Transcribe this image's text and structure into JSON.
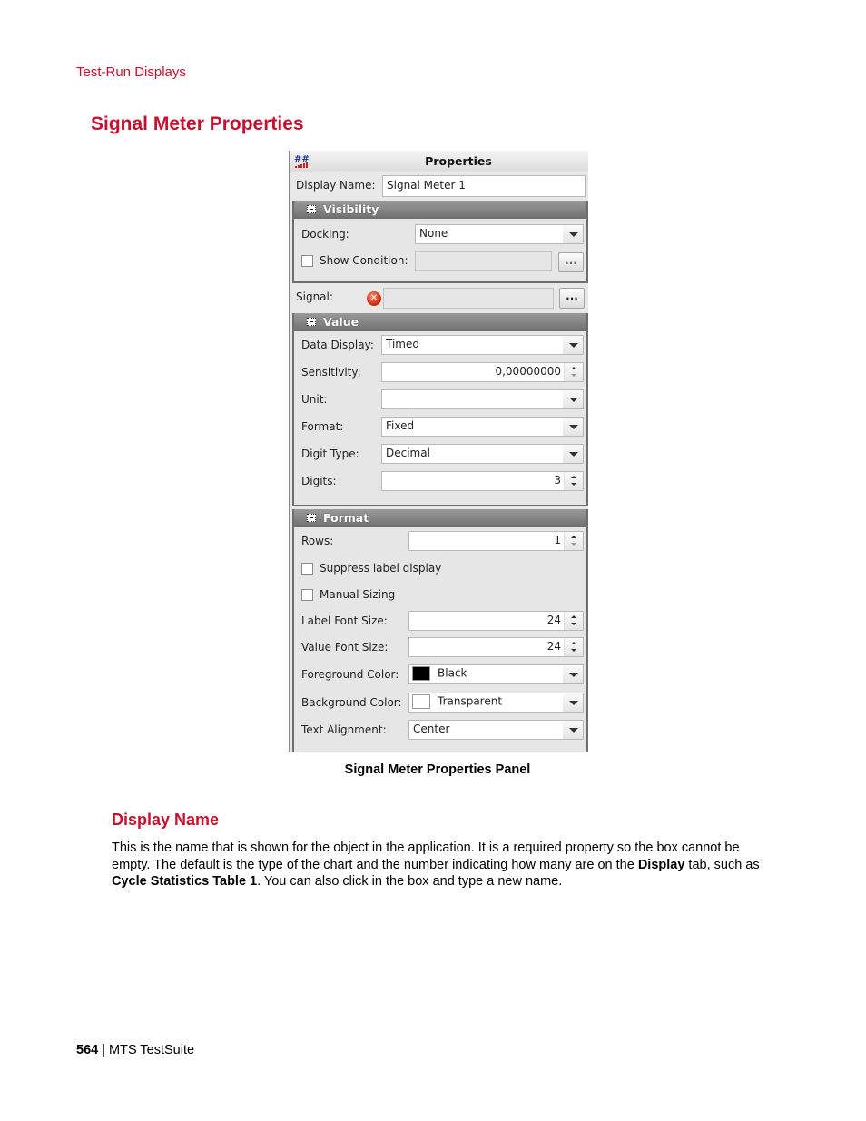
{
  "running_head": "Test-Run Displays",
  "page_title": "Signal Meter Properties",
  "panel": {
    "title": "Properties",
    "app_icon": "signal-meter-icon",
    "display_name": {
      "label": "Display Name:",
      "value": "Signal Meter 1"
    },
    "visibility": {
      "header": "Visibility",
      "docking": {
        "label": "Docking:",
        "value": "None"
      },
      "show_condition": {
        "label": "Show Condition:",
        "checked": false,
        "value": "",
        "button": "..."
      }
    },
    "signal": {
      "label": "Signal:",
      "status_icon": "error-icon",
      "value": "",
      "button": "..."
    },
    "value": {
      "header": "Value",
      "data_display": {
        "label": "Data Display:",
        "value": "Timed"
      },
      "sensitivity": {
        "label": "Sensitivity:",
        "value": "0,00000000"
      },
      "unit": {
        "label": "Unit:",
        "value": ""
      },
      "format": {
        "label": "Format:",
        "value": "Fixed"
      },
      "digit_type": {
        "label": "Digit Type:",
        "value": "Decimal"
      },
      "digits": {
        "label": "Digits:",
        "value": "3"
      }
    },
    "format": {
      "header": "Format",
      "rows": {
        "label": "Rows:",
        "value": "1"
      },
      "suppress_label": {
        "label": "Suppress label display",
        "checked": false
      },
      "manual_sizing": {
        "label": "Manual Sizing",
        "checked": false
      },
      "label_font_size": {
        "label": "Label Font Size:",
        "value": "24"
      },
      "value_font_size": {
        "label": "Value Font Size:",
        "value": "24"
      },
      "foreground_color": {
        "label": "Foreground Color:",
        "value": "Black",
        "swatch": "#000000"
      },
      "background_color": {
        "label": "Background Color:",
        "value": "Transparent",
        "swatch": "#ffffff"
      },
      "text_alignment": {
        "label": "Text Alignment:",
        "value": "Center"
      }
    }
  },
  "caption": "Signal Meter Properties Panel",
  "section": {
    "title": "Display Name",
    "body": [
      {
        "text": "This is the name that is shown for the object in the application. It is a required property so the box cannot be empty. The default is the type of the chart and the number indicating how many are on the ",
        "bold": false
      },
      {
        "text": "Display",
        "bold": true
      },
      {
        "text": " tab, such as ",
        "bold": false
      },
      {
        "text": "Cycle Statistics Table 1",
        "bold": true
      },
      {
        "text": ". You can also click in the box and type a new name.",
        "bold": false
      }
    ]
  },
  "footer": {
    "page_number": "564",
    "separator": " | ",
    "product": "MTS TestSuite"
  },
  "colors": {
    "accent": "#c8102e",
    "group_header": "#7a7a7a",
    "panel_bg": "#e8e8e8"
  }
}
